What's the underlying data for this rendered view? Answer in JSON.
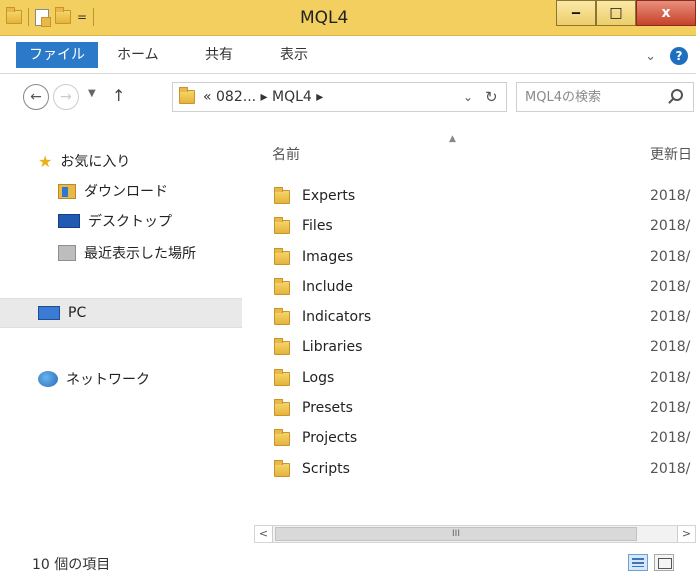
{
  "window": {
    "title": "MQL4",
    "minimize_label": "‒",
    "maximize_label": "□",
    "close_label": "x",
    "quick_access_dropdown": "="
  },
  "ribbon": {
    "tabs": [
      {
        "label": "ファイル"
      },
      {
        "label": "ホーム"
      },
      {
        "label": "共有"
      },
      {
        "label": "表示"
      }
    ],
    "expand_label": "⌄",
    "help_label": "?"
  },
  "address": {
    "path_text": "« 082... ▸ MQL4 ▸",
    "search_placeholder": "MQL4の検索"
  },
  "navigation": {
    "items": [
      {
        "label": "お気に入り",
        "icon": "star-icon"
      },
      {
        "label": "ダウンロード",
        "icon": "downloads-folder-icon"
      },
      {
        "label": "デスクトップ",
        "icon": "desktop-icon"
      },
      {
        "label": "最近表示した場所",
        "icon": "recent-places-icon"
      },
      {
        "label": "PC",
        "icon": "pc-icon"
      },
      {
        "label": "ネットワーク",
        "icon": "network-icon"
      }
    ]
  },
  "list": {
    "columns": {
      "name": "名前",
      "date": "更新日"
    },
    "items": [
      {
        "name": "Experts",
        "date": "2018/"
      },
      {
        "name": "Files",
        "date": "2018/"
      },
      {
        "name": "Images",
        "date": "2018/"
      },
      {
        "name": "Include",
        "date": "2018/"
      },
      {
        "name": "Indicators",
        "date": "2018/"
      },
      {
        "name": "Libraries",
        "date": "2018/"
      },
      {
        "name": "Logs",
        "date": "2018/"
      },
      {
        "name": "Presets",
        "date": "2018/"
      },
      {
        "name": "Projects",
        "date": "2018/"
      },
      {
        "name": "Scripts",
        "date": "2018/"
      }
    ],
    "scroll_thumb_label": "III"
  },
  "status": {
    "item_count": "10 個の項目"
  }
}
